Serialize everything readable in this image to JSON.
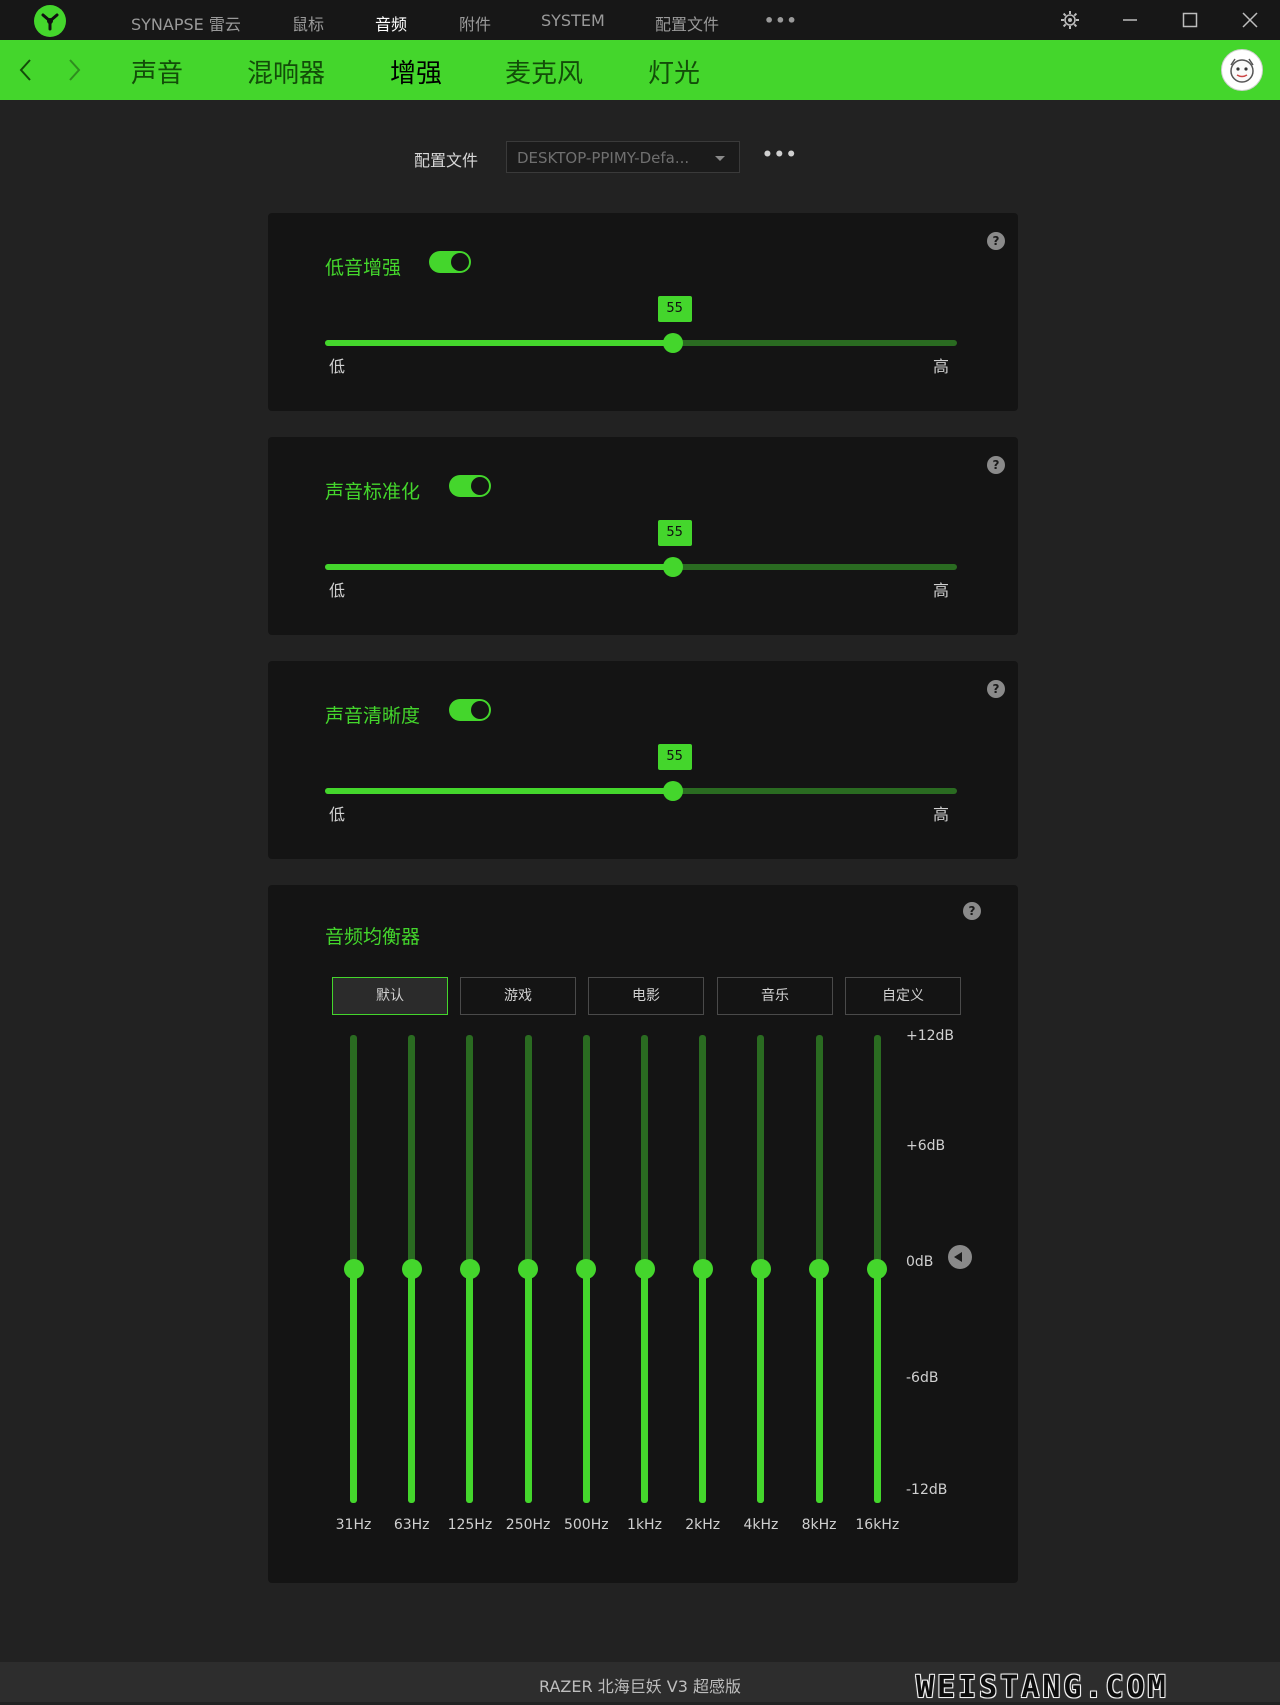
{
  "titlebar": {
    "nav": [
      {
        "label": "SYNAPSE 雷云",
        "active": false
      },
      {
        "label": "鼠标",
        "active": false
      },
      {
        "label": "音频",
        "active": true
      },
      {
        "label": "附件",
        "active": false
      },
      {
        "label": "SYSTEM",
        "active": false
      },
      {
        "label": "配置文件",
        "active": false
      }
    ],
    "more": "•••"
  },
  "subnav": {
    "tabs": [
      {
        "label": "声音",
        "active": false
      },
      {
        "label": "混响器",
        "active": false
      },
      {
        "label": "增强",
        "active": true
      },
      {
        "label": "麦克风",
        "active": false
      },
      {
        "label": "灯光",
        "active": false
      }
    ]
  },
  "profile": {
    "label": "配置文件",
    "value": "DESKTOP-PPIMY-Defa...",
    "more": "•••"
  },
  "cards": [
    {
      "title": "低音增强",
      "enabled": true,
      "value": 55,
      "low": "低",
      "high": "高"
    },
    {
      "title": "声音标准化",
      "enabled": true,
      "value": 55,
      "low": "低",
      "high": "高"
    },
    {
      "title": "声音清晰度",
      "enabled": true,
      "value": 55,
      "low": "低",
      "high": "高"
    }
  ],
  "equalizer": {
    "title": "音频均衡器",
    "presets": [
      {
        "label": "默认",
        "active": true
      },
      {
        "label": "游戏",
        "active": false
      },
      {
        "label": "电影",
        "active": false
      },
      {
        "label": "音乐",
        "active": false
      },
      {
        "label": "自定义",
        "active": false
      }
    ],
    "db_labels": [
      "+12dB",
      "+6dB",
      "0dB",
      "-6dB",
      "-12dB"
    ],
    "db_range": [
      -12,
      12
    ],
    "bands": [
      {
        "freq": "31Hz",
        "gain": 0
      },
      {
        "freq": "63Hz",
        "gain": 0
      },
      {
        "freq": "125Hz",
        "gain": 0
      },
      {
        "freq": "250Hz",
        "gain": 0
      },
      {
        "freq": "500Hz",
        "gain": 0
      },
      {
        "freq": "1kHz",
        "gain": 0
      },
      {
        "freq": "2kHz",
        "gain": 0
      },
      {
        "freq": "4kHz",
        "gain": 0
      },
      {
        "freq": "8kHz",
        "gain": 0
      },
      {
        "freq": "16kHz",
        "gain": 0
      }
    ]
  },
  "footer": {
    "device": "RAZER 北海巨妖 V3 超感版",
    "watermark": "WEISTANG.COM"
  },
  "help_symbol": "?",
  "colors": {
    "accent": "#44d62c",
    "track_dark": "#2a6b21",
    "background": "#222222",
    "card": "#141414"
  }
}
